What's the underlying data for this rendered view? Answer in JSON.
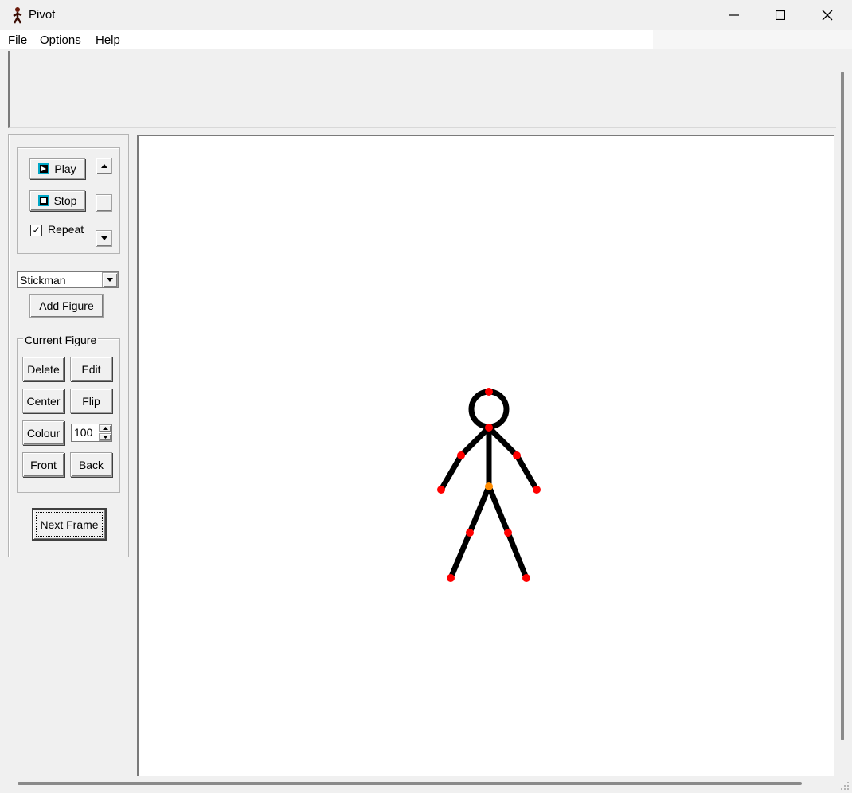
{
  "window": {
    "title": "Pivot",
    "icon": "stickman-app-icon",
    "controls": [
      "minimize-icon",
      "maximize-icon",
      "close-icon"
    ]
  },
  "menu": {
    "file": {
      "accel": "F",
      "rest": "ile"
    },
    "options": {
      "accel": "O",
      "rest": "ptions"
    },
    "help": {
      "accel": "H",
      "rest": "elp"
    }
  },
  "playback": {
    "play_label": "Play",
    "stop_label": "Stop",
    "repeat_label": "Repeat",
    "repeat_checked": true,
    "repeat_mark": "✓",
    "speed_up_icon": "scroll-up-arrow-icon",
    "speed_down_icon": "scroll-down-arrow-icon"
  },
  "figure_select": {
    "value": "Stickman",
    "add_label": "Add Figure"
  },
  "current_figure": {
    "legend": "Current Figure",
    "delete_label": "Delete",
    "edit_label": "Edit",
    "center_label": "Center",
    "flip_label": "Flip",
    "colour_label": "Colour",
    "scale_value": "100",
    "front_label": "Front",
    "back_label": "Back"
  },
  "next_frame_label": "Next Frame",
  "colors": {
    "body": "#000000",
    "joint_handle": "#ff0000",
    "origin_handle": "#ff8c00",
    "button_icon_accent": "#00a7c7"
  }
}
